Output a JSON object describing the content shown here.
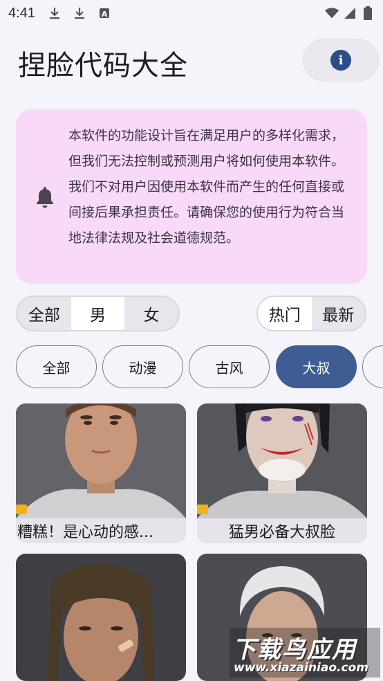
{
  "status_bar": {
    "time": "4:41",
    "icons_left": [
      "download-icon",
      "download-icon",
      "font-icon"
    ],
    "icons_right": [
      "wifi-icon",
      "signal-icon",
      "battery-icon"
    ]
  },
  "header": {
    "title": "捏脸代码大全",
    "info_button_icon": "info-icon",
    "accent": "#2d4d8a"
  },
  "notice": {
    "icon": "bell-icon",
    "text": "本软件的功能设计旨在满足用户的多样化需求，但我们无法控制或预测用户将如何使用本软件。我们不对用户因使用本软件而产生的任何直接或间接后果承担责任。请确保您的使用行为符合当地法律法规及社会道德规范。",
    "background": "#f9d9f8"
  },
  "gender_filter": {
    "options": [
      "全部",
      "男",
      "女"
    ],
    "selected": "男"
  },
  "sort_filter": {
    "options": [
      "热门",
      "最新"
    ],
    "selected": "热门"
  },
  "category_chips": {
    "items": [
      "全部",
      "动漫",
      "古风",
      "大叔"
    ],
    "selected": "大叔"
  },
  "cards": [
    {
      "caption": "糟糕！是心动的感...",
      "vip": true
    },
    {
      "caption": "猛男必备大叔脸",
      "vip": true
    },
    {
      "caption": "",
      "vip": false
    },
    {
      "caption": "",
      "vip": false
    }
  ],
  "watermark": {
    "title": "下载鸟应用",
    "url": "www.xiazainiao.com"
  }
}
